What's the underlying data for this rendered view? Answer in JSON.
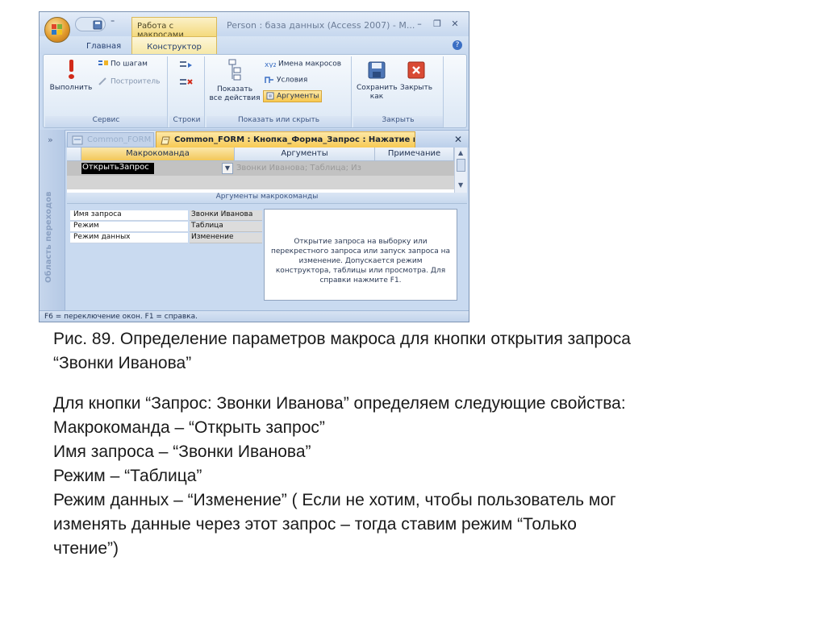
{
  "window": {
    "title": "Person : база данных (Access 2007) - М...",
    "context_tab": "Работа с макросами",
    "qat_dropdown": "⁼",
    "controls": {
      "minimize": "–",
      "restore": "❐",
      "close": "✕"
    }
  },
  "ribbon_tabs": {
    "home": "Главная",
    "design": "Конструктор",
    "help": "?"
  },
  "ribbon": {
    "service": {
      "label": "Сервис",
      "run": "Выполнить",
      "step": "По шагам",
      "builder": "Построитель"
    },
    "rows": {
      "label": "Строки"
    },
    "show_hide": {
      "label": "Показать или скрыть",
      "show_all_1": "Показать",
      "show_all_2": "все действия",
      "macro_names": "Имена макросов",
      "conditions": "Условия",
      "arguments": "Аргументы"
    },
    "close_group": {
      "label": "Закрыть",
      "save_as_1": "Сохранить",
      "save_as_2": "как",
      "close": "Закрыть"
    }
  },
  "doc_tabs": {
    "nav_toggle": "»",
    "prev_tab": "Common_FORM",
    "active_tab": "Common_FORM : Кнопка_Форма_Запрос : Нажатие кно...",
    "close": "✕"
  },
  "nav_pane": {
    "label": "Область переходов"
  },
  "grid": {
    "headers": [
      "Макрокоманда",
      "Аргументы",
      "Примечание"
    ],
    "rows": [
      {
        "macro": "ОткрытьЗапрос",
        "args": "Звонки Иванова; Таблица; Из"
      }
    ]
  },
  "args_pane": {
    "title": "Аргументы макрокоманды",
    "props": [
      {
        "key": "Имя запроса",
        "value": "Звонки Иванова"
      },
      {
        "key": "Режим",
        "value": "Таблица"
      },
      {
        "key": "Режим данных",
        "value": "Изменение"
      }
    ],
    "help": "Открытие запроса на выборку или перекрестного запроса или запуск запроса на изменение. Допускается режим конструктора, таблицы или просмотра. Для справки нажмите F1."
  },
  "statusbar": "F6 = переключение окон.  F1 = справка.",
  "caption": [
    "Рис. 89. Определение параметров макроса для кнопки открытия запроса",
    "“Звонки Иванова”"
  ],
  "body": [
    "Для кнопки “Запрос: Звонки Иванова” определяем следующие свойства:",
    "Макрокоманда – “Открыть запрос”",
    "Имя запроса – “Звонки Иванова”",
    "Режим – “Таблица”",
    "Режим данных – “Изменение” ( Если не хотим, чтобы пользователь мог",
    "изменять данные через этот запрос – тогда ставим режим “Только",
    "чтение”)"
  ],
  "colors": {
    "ribbon_bg": "#dbe7f5",
    "active_tab": "#f7c84f",
    "selected_cell": "#000000",
    "window_frame": "#c9daf0"
  }
}
